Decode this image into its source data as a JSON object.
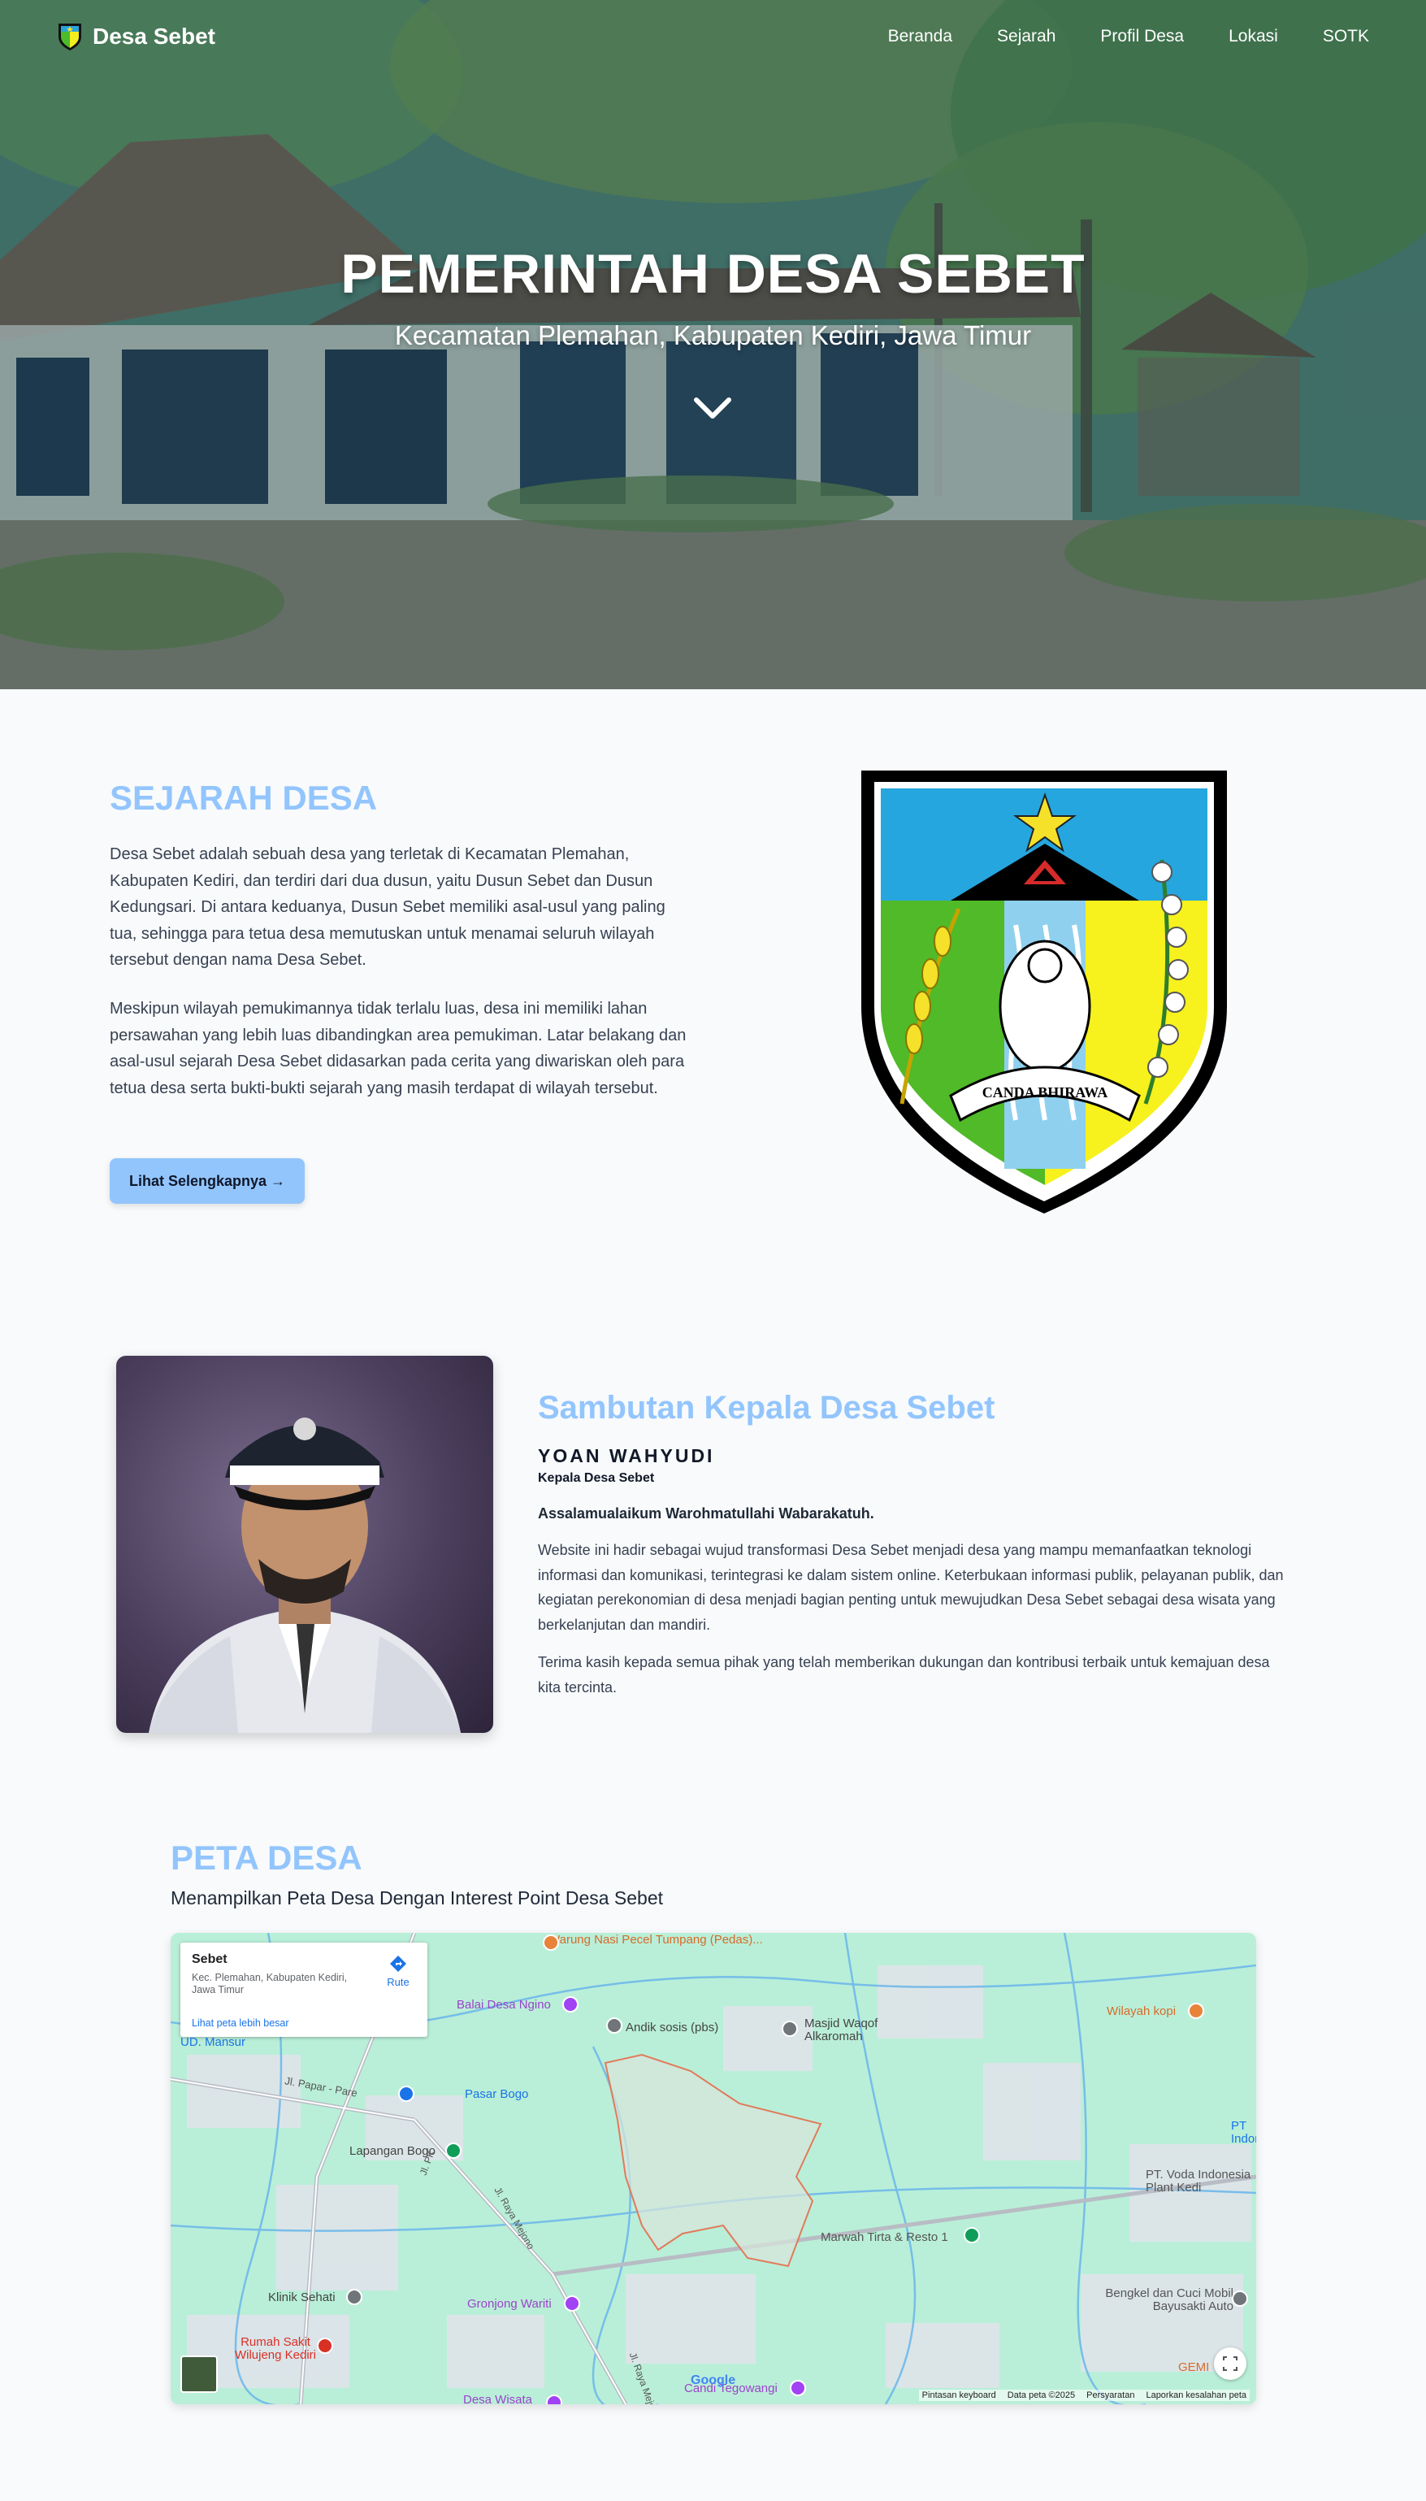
{
  "nav": {
    "brand": "Desa Sebet",
    "links": [
      "Beranda",
      "Sejarah",
      "Profil Desa",
      "Lokasi",
      "SOTK"
    ]
  },
  "hero": {
    "title": "PEMERINTAH DESA SEBET",
    "subtitle": "Kecamatan Plemahan, Kabupaten Kediri, Jawa Timur"
  },
  "sejarah": {
    "title": "SEJARAH DESA",
    "p1": "Desa Sebet adalah sebuah desa yang terletak di Kecamatan Plemahan, Kabupaten Kediri, dan terdiri dari dua dusun, yaitu Dusun Sebet dan Dusun Kedungsari. Di antara keduanya, Dusun Sebet memiliki asal-usul yang paling tua, sehingga para tetua desa memutuskan untuk menamai seluruh wilayah tersebut dengan nama Desa Sebet.",
    "p2": "Meskipun wilayah pemukimannya tidak terlalu luas, desa ini memiliki lahan persawahan yang lebih luas dibandingkan area pemukiman. Latar belakang dan asal-usul sejarah Desa Sebet didasarkan pada cerita yang diwariskan oleh para tetua desa serta bukti-bukti sejarah yang masih terdapat di wilayah tersebut.",
    "button": "Lihat Selengkapnya →",
    "emblem_text": "CANDA BHIRAWA"
  },
  "sambutan": {
    "title": "Sambutan Kepala Desa Sebet",
    "name": "YOAN WAHYUDI",
    "role": "Kepala Desa Sebet",
    "greeting": "Assalamualaikum Warohmatullahi Wabarakatuh.",
    "p1": "Website ini hadir sebagai wujud transformasi Desa Sebet menjadi desa yang mampu memanfaatkan teknologi informasi dan komunikasi, terintegrasi ke dalam sistem online. Keterbukaan informasi publik, pelayanan publik, dan kegiatan perekonomian di desa menjadi bagian penting untuk mewujudkan Desa Sebet sebagai desa wisata yang berkelanjutan dan mandiri.",
    "p2": "Terima kasih kepada semua pihak yang telah memberikan dukungan dan kontribusi terbaik untuk kemajuan desa kita tercinta."
  },
  "peta": {
    "title": "PETA DESA",
    "subtitle": "Menampilkan Peta Desa Dengan Interest Point Desa Sebet",
    "card": {
      "title": "Sebet",
      "address": "Kec. Plemahan, Kabupaten Kediri, Jawa Timur",
      "link": "Lihat peta lebih besar",
      "route": "Rute"
    },
    "labels": {
      "warung": "Warung Nasi Pecel Tumpang (Pedas)...",
      "balai": "Balai Desa Ngino",
      "andik": "Andik sosis (pbs)",
      "masjid": "Masjid Waqof Alkaromah",
      "wilayah": "Wilayah kopi",
      "ud": "UD. Mansur",
      "papar": "Jl. Papar - Pare",
      "pasar": "Pasar Bogo",
      "lapangan": "Lapangan Bogo",
      "pt1": "PT Indon",
      "pt2": "PT. Voda Indonesia Plant Kedi",
      "marwah": "Marwah Tirta & Resto 1",
      "klinik": "Klinik Sehati",
      "gronjong": "Gronjong Wariti",
      "bengkel": "Bengkel dan Cuci Mobil Bayusakti Auto",
      "rumah_sakit": "Rumah Sakit Wilujeng Kediri",
      "candi": "Candi Tegowangi",
      "desa_wisata": "Desa Wisata",
      "gem": "GEMI",
      "raya_mejono": "Jl. Raya Mejono",
      "pk": "Jl. PK"
    },
    "footer": [
      "Pintasan keyboard",
      "Data peta ©2025",
      "Persyaratan",
      "Laporkan kesalahan peta"
    ],
    "google": "Google"
  }
}
